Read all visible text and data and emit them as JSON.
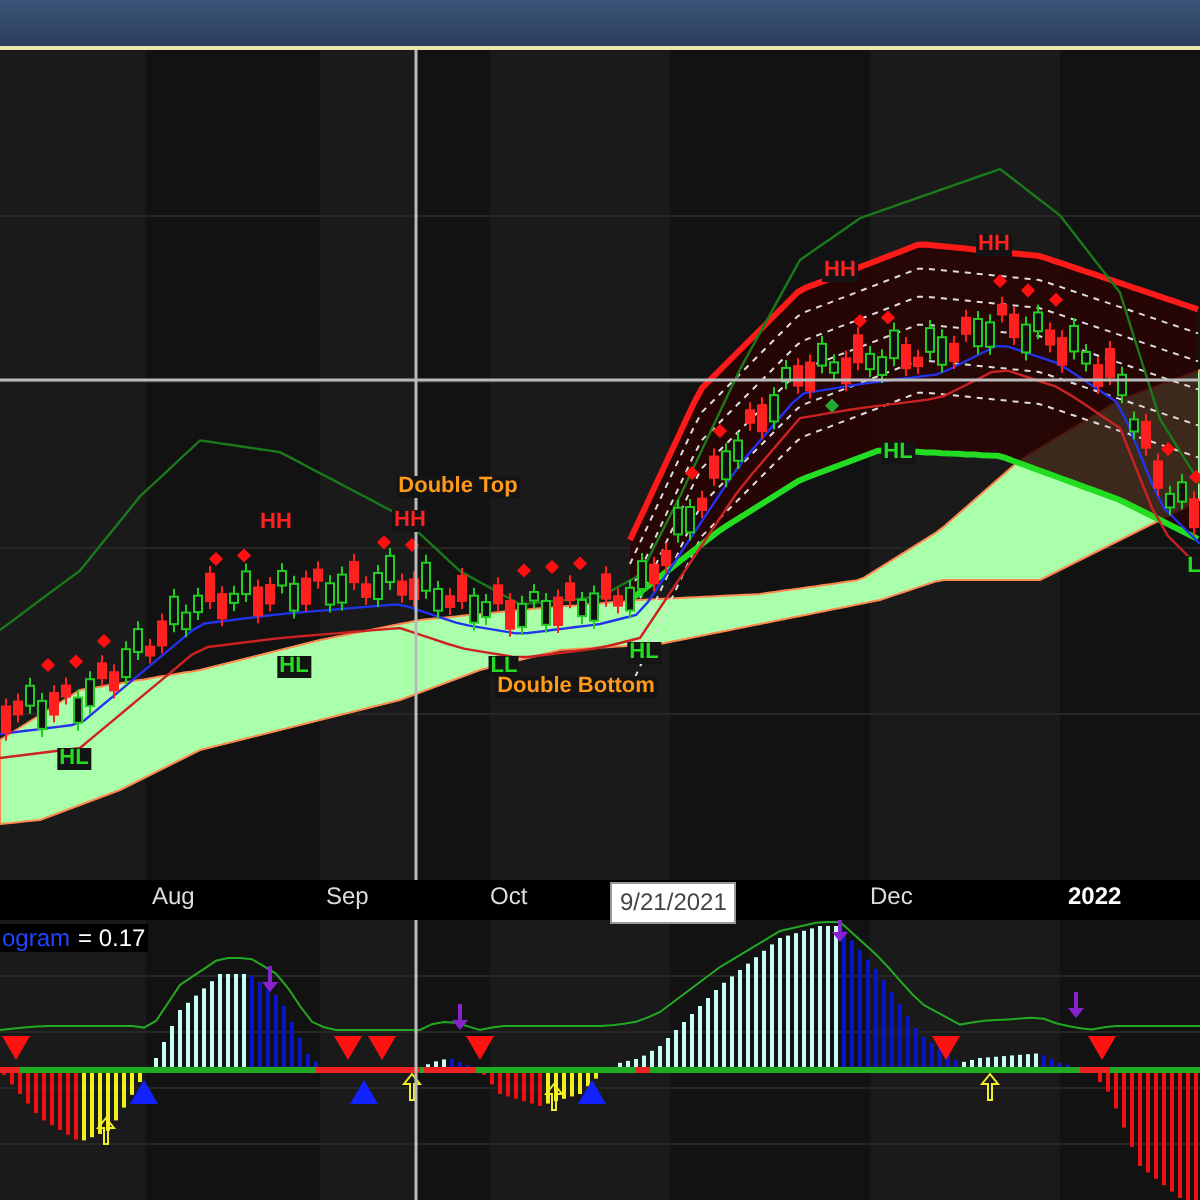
{
  "price_chart": {
    "annotations": [
      {
        "text": "HH",
        "kind": "high"
      },
      {
        "text": "HH",
        "kind": "high"
      },
      {
        "text": "HL",
        "kind": "low"
      },
      {
        "text": "Double Top",
        "kind": "pattern"
      },
      {
        "text": "HH",
        "kind": "high"
      },
      {
        "text": "HH",
        "kind": "high"
      },
      {
        "text": "L",
        "kind": "low"
      },
      {
        "text": "HL",
        "kind": "low"
      },
      {
        "text": "LL",
        "kind": "low"
      },
      {
        "text": "HL",
        "kind": "low"
      },
      {
        "text": "Double Bottom",
        "kind": "pattern"
      },
      {
        "text": "HL",
        "kind": "low"
      }
    ]
  },
  "x_axis": {
    "labels": [
      {
        "text": "Aug",
        "bold": false
      },
      {
        "text": "Sep",
        "bold": false
      },
      {
        "text": "Oct",
        "bold": false
      },
      {
        "text": "Dec",
        "bold": false
      },
      {
        "text": "2022",
        "bold": true
      }
    ],
    "crosshair_date": "9/21/2021"
  },
  "indicator_panel": {
    "legend_name": "ogram",
    "legend_value": "= 0.17"
  }
}
